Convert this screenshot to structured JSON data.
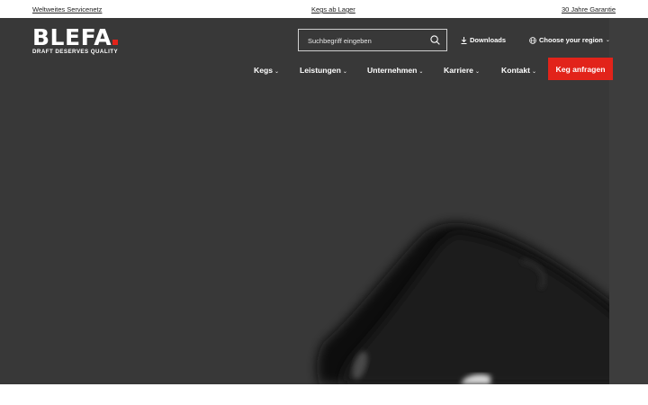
{
  "topbar": {
    "left_link": "Weltweites Servicenetz",
    "center_link": "Kegs ab Lager",
    "right_link": "30 Jahre Garantie"
  },
  "logo": {
    "name": "BLEFA",
    "tagline": "DRAFT DESERVES QUALITY",
    "accent_color": "#e2231a"
  },
  "search": {
    "placeholder": "Suchbegriff eingeben",
    "value": "",
    "icon": "search-icon"
  },
  "utility": {
    "downloads": "Downloads",
    "downloads_icon": "download-icon",
    "region": "Choose your region",
    "region_icon": "globe-icon"
  },
  "nav": {
    "items": [
      {
        "label": "Kegs"
      },
      {
        "label": "Leistungen"
      },
      {
        "label": "Unternehmen"
      },
      {
        "label": "Karriere"
      },
      {
        "label": "Kontakt"
      }
    ],
    "cta": "Keg anfragen"
  },
  "colors": {
    "header_bg": "#383838",
    "accent": "#e2231a",
    "text_light": "#ffffff"
  }
}
